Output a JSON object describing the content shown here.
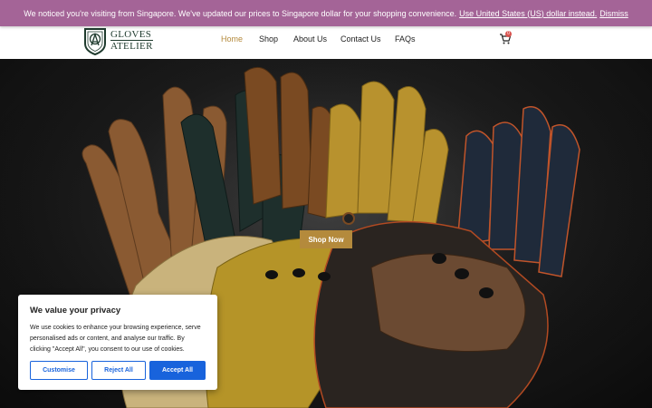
{
  "notice": {
    "message": "We noticed you're visiting from Singapore. We've updated our prices to Singapore dollar for your shopping convenience.",
    "switch_link": "Use United States (US) dollar instead.",
    "dismiss_link": "Dismiss"
  },
  "brand": {
    "line1": "GLOVES",
    "line2": "ATELIER",
    "monogram": "GA",
    "color": "#1f3b2e"
  },
  "nav": {
    "items": [
      {
        "label": "Home",
        "active": true
      },
      {
        "label": "Shop",
        "active": false
      },
      {
        "label": "About Us",
        "active": false
      },
      {
        "label": "Contact Us",
        "active": false
      },
      {
        "label": "FAQs",
        "active": false
      }
    ],
    "cart_icon": "cart-icon",
    "cart_count": "0"
  },
  "hero": {
    "cta_label": "Shop Now",
    "accent": "#b48a3c"
  },
  "cookie_banner": {
    "title": "We value your privacy",
    "body": "We use cookies to enhance your browsing experience, serve personalised ads or content, and analyse our traffic. By clicking \"Accept All\", you consent to our use of cookies.",
    "customise_label": "Customise",
    "reject_label": "Reject All",
    "accept_label": "Accept All",
    "accent": "#1863dc"
  },
  "colors": {
    "notice_bg": "#a46497",
    "nav_active": "#b48a3c"
  }
}
